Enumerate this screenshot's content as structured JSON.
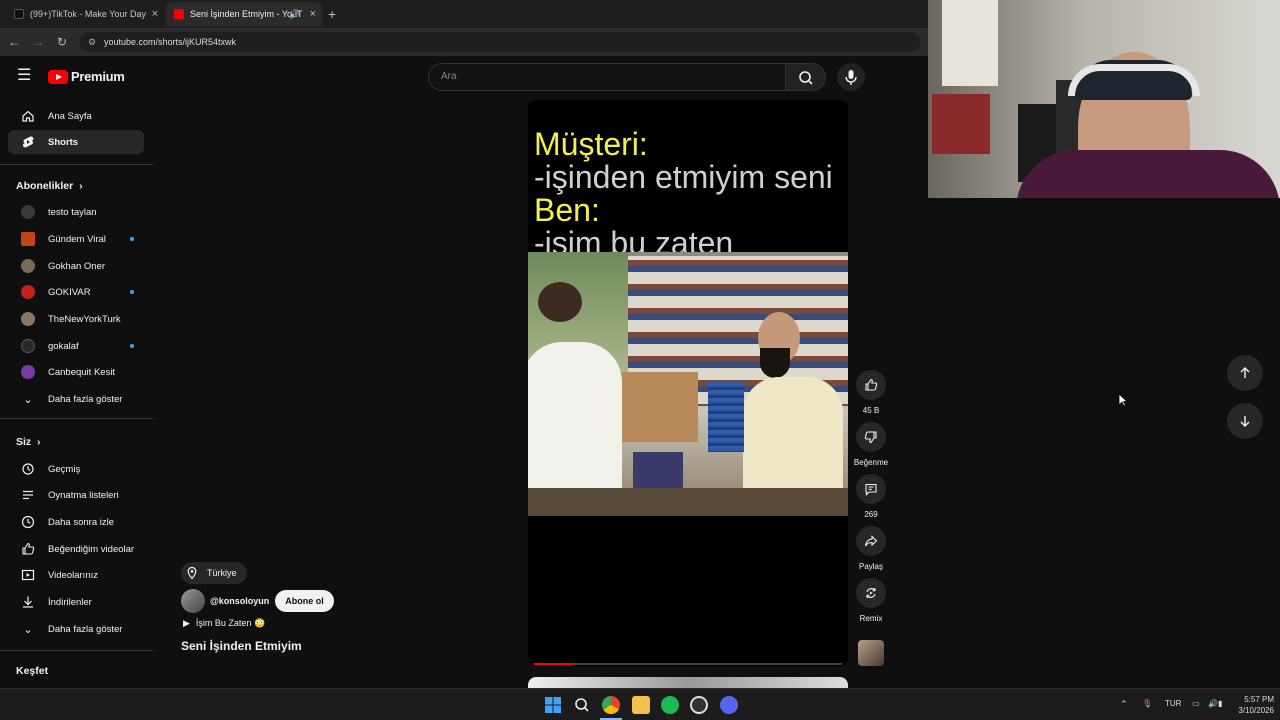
{
  "browser": {
    "tabs": [
      {
        "title": "(99+)TikTok - Make Your Day",
        "close": "×"
      },
      {
        "title": "Seni İşinden Etmiyim - YouT",
        "close": "×",
        "active": true
      }
    ],
    "new_tab": "+",
    "url": "youtube.com/shorts/ijKUR54txwk",
    "nav": {
      "back": "←",
      "forward": "→",
      "reload": "↻"
    }
  },
  "masthead": {
    "menu_icon": "☰",
    "logo_text": "Premium",
    "search_placeholder": "Ara"
  },
  "sidebar": {
    "main": [
      {
        "label": "Ana Sayfa",
        "icon": "home-icon"
      },
      {
        "label": "Shorts",
        "icon": "shorts-icon",
        "active": true
      }
    ],
    "subscriptions_header": "Abonelikler",
    "subscriptions": [
      {
        "label": "testo taylan",
        "color": "#3a3a3a"
      },
      {
        "label": "Gündem Viral",
        "color": "#c1441b",
        "dot": true
      },
      {
        "label": "Gokhan Oner",
        "color": "#7a6a55"
      },
      {
        "label": "GOKIVAR",
        "color": "#c42020",
        "dot": true
      },
      {
        "label": "TheNewYorkTurk",
        "color": "#8a7560"
      },
      {
        "label": "gokalaf",
        "color": "#2a2a2a",
        "dot": true
      },
      {
        "label": "Canbequit Kesit",
        "color": "#7a3aa8"
      }
    ],
    "show_more_1": "Daha fazla göster",
    "you_header": "Siz",
    "you_items": [
      {
        "label": "Geçmiş",
        "icon": "history-icon"
      },
      {
        "label": "Oynatma listeleri",
        "icon": "playlist-icon"
      },
      {
        "label": "Daha sonra izle",
        "icon": "clock-icon"
      },
      {
        "label": "Beğendiğim videolar",
        "icon": "thumbs-up-icon"
      },
      {
        "label": "Videolarınız",
        "icon": "video-icon"
      },
      {
        "label": "İndirilenler",
        "icon": "download-icon"
      }
    ],
    "show_more_2": "Daha fazla göster",
    "explore_header": "Keşfet"
  },
  "short": {
    "caption": {
      "line1": "Müşteri:",
      "line2": "-işinden etmiyim seni",
      "line3": "Ben:",
      "line4": "-işim bu zaten"
    },
    "progress": 0.13,
    "location": "Türkiye",
    "channel": "@konsoloyun",
    "subscribe": "Abone ol",
    "sound": "İşim Bu Zaten 😳",
    "title": "Seni İşinden Etmiyim"
  },
  "actions": {
    "likes": "45 B",
    "dislike": "Beğenme",
    "comments": "269",
    "share": "Paylaş",
    "remix": "Remix"
  },
  "taskbar": {
    "lang": "TUR",
    "time": "5:57 PM",
    "date": "3/10/2026"
  },
  "colors": {
    "accent_red": "#ff0000",
    "caption_yellow": "#f4f049",
    "chip_bg": "#272727"
  }
}
